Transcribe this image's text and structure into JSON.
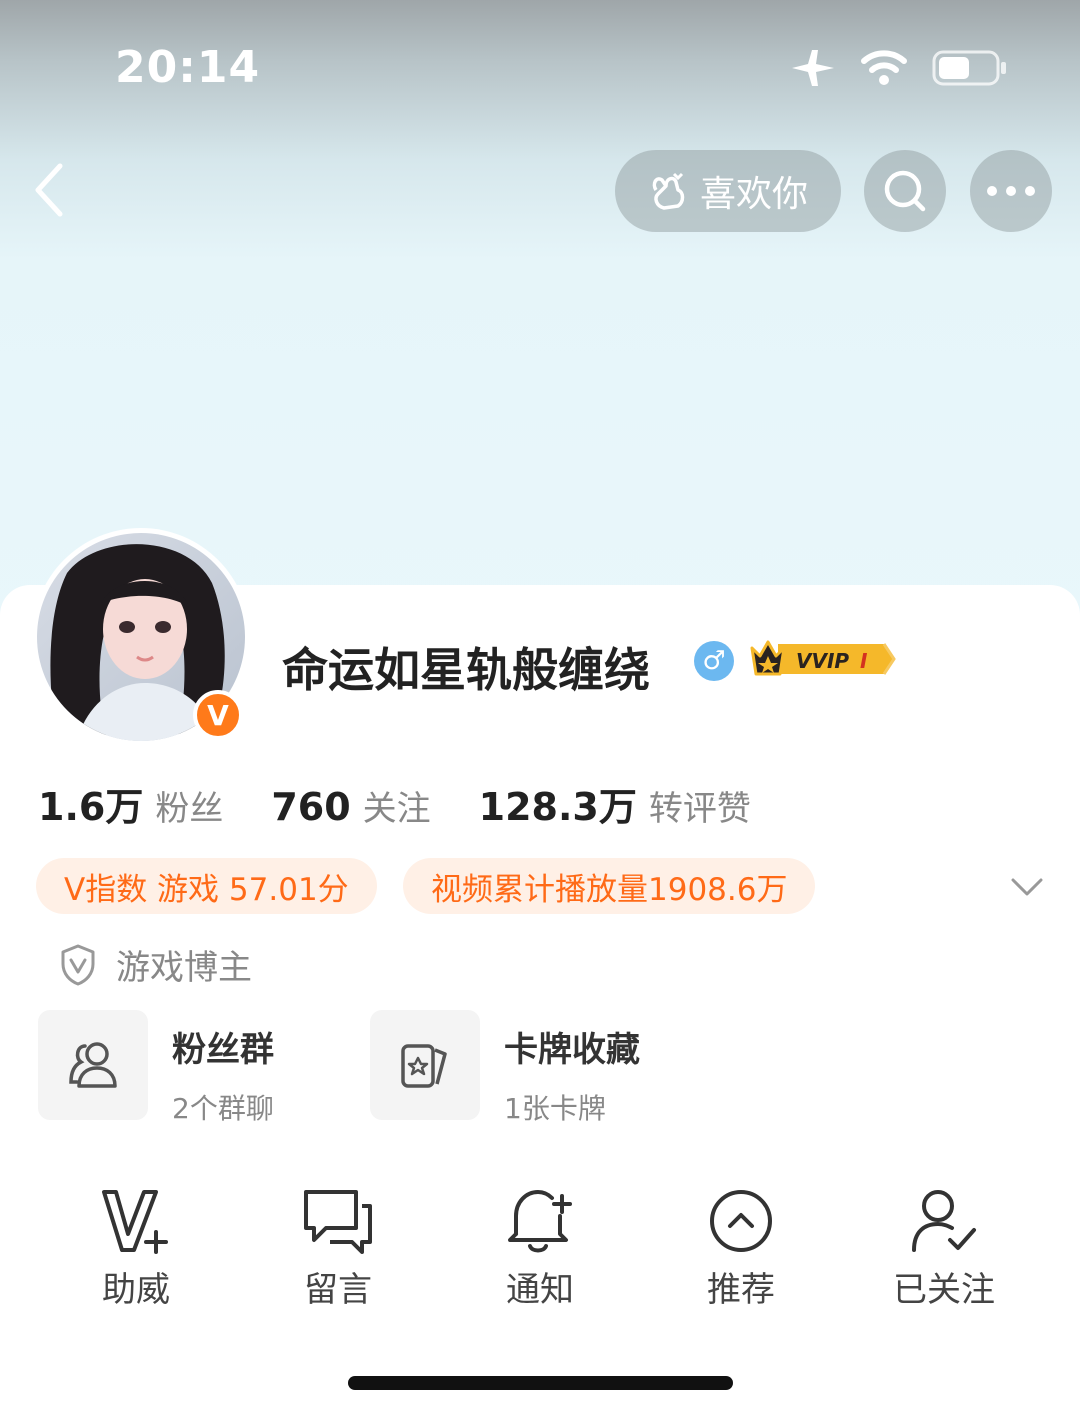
{
  "status_bar": {
    "time": "20:14"
  },
  "top_bar": {
    "like_label": "喜欢你"
  },
  "profile": {
    "username": "命运如星轨般缠绕",
    "gender_symbol": "♂",
    "vip_label": "VVIP",
    "vip_level": "I",
    "verified_badge": "V",
    "stats": [
      {
        "value": "1.6万",
        "label": "粉丝"
      },
      {
        "value": "760",
        "label": "关注"
      },
      {
        "value": "128.3万",
        "label": "转评赞"
      }
    ],
    "tags": [
      "V指数 游戏 57.01分",
      "视频累计播放量1908.6万"
    ],
    "certification": "游戏博主"
  },
  "features": [
    {
      "title": "粉丝群",
      "subtitle": "2个群聊",
      "icon": "group-icon"
    },
    {
      "title": "卡牌收藏",
      "subtitle": "1张卡牌",
      "icon": "card-icon"
    }
  ],
  "actions": [
    {
      "label": "助威",
      "icon": "cheer-icon"
    },
    {
      "label": "留言",
      "icon": "message-icon"
    },
    {
      "label": "通知",
      "icon": "bell-icon"
    },
    {
      "label": "推荐",
      "icon": "recommend-icon"
    },
    {
      "label": "已关注",
      "icon": "followed-icon"
    }
  ],
  "colors": {
    "accent": "#ff6a17",
    "tag_bg": "#fff0e6",
    "gender": "#6cb8f0",
    "vip_gold": "#f5b82a"
  }
}
